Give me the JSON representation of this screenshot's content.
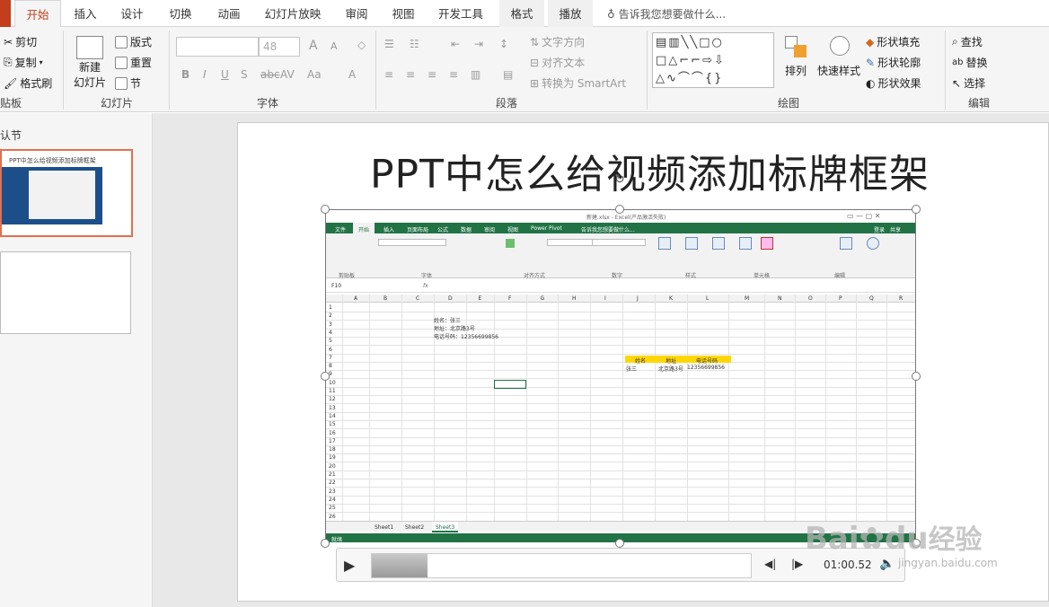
{
  "tabs": [
    "开始",
    "插入",
    "设计",
    "切换",
    "动画",
    "幻灯片放映",
    "审阅",
    "视图",
    "开发工具",
    "格式",
    "播放"
  ],
  "tell_me": "告诉我您想要做什么...",
  "clipboard": {
    "cut": "剪切",
    "copy": "复制",
    "format_painter": "格式刷",
    "label": "贴板"
  },
  "slides_group": {
    "new_slide": "新建",
    "new_slide2": "幻灯片",
    "layout": "版式",
    "reset": "重置",
    "section": "节",
    "label": "幻灯片"
  },
  "font_group": {
    "size": "48",
    "label": "字体"
  },
  "paragraph_group": {
    "text_direction": "文字方向",
    "align_text": "对齐文本",
    "smartart": "转换为 SmartArt",
    "label": "段落"
  },
  "drawing_group": {
    "arrange": "排列",
    "quick_styles": "快速样式",
    "fill": "形状填充",
    "outline": "形状轮廓",
    "effects": "形状效果",
    "label": "绘图"
  },
  "editing_group": {
    "find": "查找",
    "replace": "替换",
    "select": "选择",
    "label": "编辑"
  },
  "panel": {
    "section": "认节",
    "thumb1_title": "PPT中怎么给视频添加标牌框架"
  },
  "slide": {
    "title": "PPT中怎么给视频添加标牌框架"
  },
  "excel": {
    "title": "新建.xlsx - Excel(产品激活失败)",
    "tabs": [
      "文件",
      "开始",
      "插入",
      "页面布局",
      "公式",
      "数据",
      "审阅",
      "视图",
      "Power Pivot"
    ],
    "tell": "告诉我您想要做什么...",
    "share": "共享",
    "login": "登录",
    "namebox": "F10",
    "fx": "fx",
    "groups": [
      "剪贴板",
      "字体",
      "对齐方式",
      "数字",
      "样式",
      "单元格",
      "编辑"
    ],
    "cols": [
      "A",
      "B",
      "C",
      "D",
      "E",
      "F",
      "G",
      "H",
      "I",
      "J",
      "K",
      "L",
      "M",
      "N",
      "O",
      "P",
      "Q",
      "R"
    ],
    "rows": [
      "1",
      "2",
      "3",
      "4",
      "5",
      "6",
      "7",
      "8",
      "9",
      "10",
      "11",
      "12",
      "13",
      "14",
      "15",
      "16",
      "17",
      "18",
      "19",
      "20",
      "21",
      "22",
      "23",
      "24",
      "25",
      "26"
    ],
    "cell_d2": "姓名：张三",
    "cell_d3": "地址：北京路3号",
    "cell_d4": "电话号码：12356699856",
    "hdr_name": "姓名",
    "hdr_addr": "地址",
    "hdr_phone": "电话号码",
    "val_name": "张三",
    "val_addr": "北京路3号",
    "val_phone": "12356699856",
    "sheets": [
      "Sheet1",
      "Sheet2",
      "Sheet3"
    ],
    "status": "就绪"
  },
  "player": {
    "time": "01:00.52"
  },
  "watermark": {
    "brand": "Bai",
    "brand2": "du",
    "jy": "经验",
    "url": "jingyan.baidu.com"
  }
}
